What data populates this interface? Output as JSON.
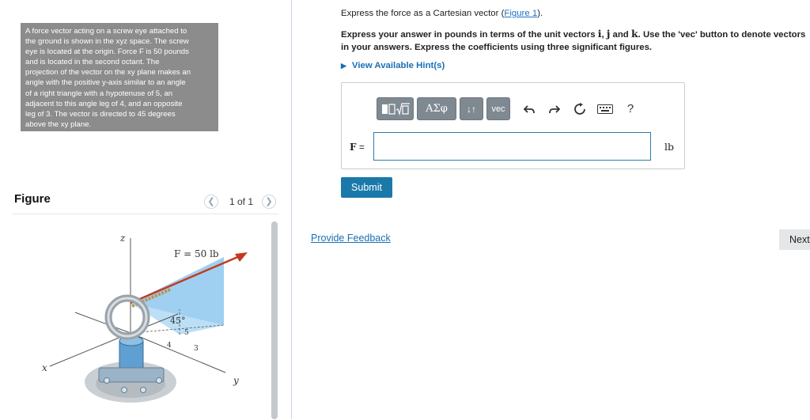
{
  "problem": {
    "lines": [
      "A force vector acting on a screw eye attached to",
      "the ground is shown in the xyz space. The screw",
      "eye is located at the origin. Force F is 50 pounds",
      "and is located in the second octant. The",
      "projection of the vector on the xy plane makes an",
      "angle with the positive y-axis similar to an angle",
      "of a right triangle with a hypotenuse of 5, an",
      "adjacent to this angle leg of 4, and an opposite",
      "leg of 3. The vector is directed to 45 degrees",
      "above the xy plane."
    ]
  },
  "figure": {
    "title": "Figure",
    "page_label": "1 of 1",
    "prev_icon": "chevron-left-icon",
    "next_icon": "chevron-right-icon",
    "labels": {
      "z": "z",
      "x": "x",
      "y": "y",
      "force": "F = 50 lb",
      "angle": "45°",
      "five": "5",
      "four": "4",
      "three": "3"
    }
  },
  "question": {
    "prompt_prefix": "Express the force as a Cartesian vector (",
    "figure_link": "Figure 1",
    "prompt_suffix": ").",
    "instr_a": "Express your answer in pounds in terms of the unit vectors ",
    "unit_i": "i",
    "sep1": ", ",
    "unit_j": "j",
    "sep2": " and ",
    "unit_k": "k",
    "instr_b": ". Use the 'vec' button to denote vectors in your answers. Express the coefficients using three significant figures.",
    "hints_label": "View Available Hint(s)"
  },
  "toolbar": {
    "greek_label": "ΑΣφ",
    "arrows_label": "↓↑",
    "vec_label": "vec",
    "help_label": "?",
    "icons": [
      "templates-icon",
      "undo-icon",
      "redo-icon",
      "reset-icon",
      "keyboard-icon",
      "help-icon"
    ]
  },
  "answer": {
    "var_label": "F",
    "equals": " =",
    "value": "",
    "unit": "lb"
  },
  "actions": {
    "submit_label": "Submit",
    "feedback_label": "Provide Feedback",
    "next_label": "Next"
  },
  "colors": {
    "link": "#1a73c8",
    "submit_bg": "#1a79a9",
    "toolbar_btn": "#7f8992",
    "problem_bg": "#8c8c8c",
    "plane_blue": "#8ec7ef"
  }
}
